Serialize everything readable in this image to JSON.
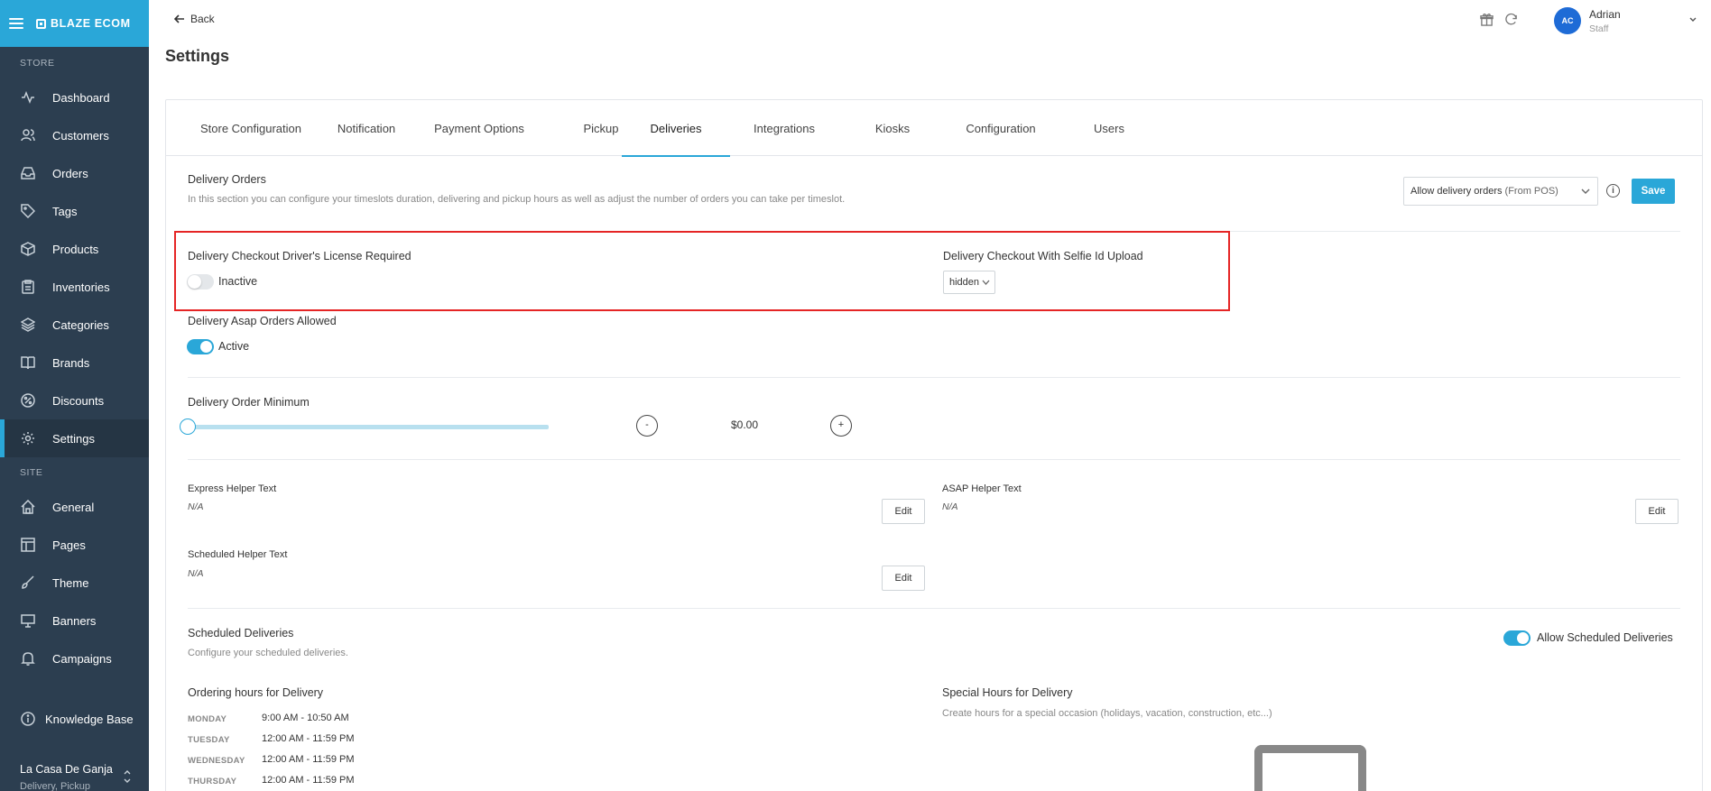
{
  "brand": {
    "name": "BLAZE ECOM"
  },
  "sidebar": {
    "store_label": "STORE",
    "site_label": "SITE",
    "store_items": [
      {
        "label": "Dashboard",
        "icon": "activity-icon"
      },
      {
        "label": "Customers",
        "icon": "users-icon"
      },
      {
        "label": "Orders",
        "icon": "inbox-icon"
      },
      {
        "label": "Tags",
        "icon": "tag-icon"
      },
      {
        "label": "Products",
        "icon": "box-icon"
      },
      {
        "label": "Inventories",
        "icon": "clipboard-icon"
      },
      {
        "label": "Categories",
        "icon": "layers-icon"
      },
      {
        "label": "Brands",
        "icon": "book-icon"
      },
      {
        "label": "Discounts",
        "icon": "percent-icon"
      },
      {
        "label": "Settings",
        "icon": "gear-icon",
        "active": true
      }
    ],
    "site_items": [
      {
        "label": "General",
        "icon": "home-icon"
      },
      {
        "label": "Pages",
        "icon": "layout-icon"
      },
      {
        "label": "Theme",
        "icon": "brush-icon"
      },
      {
        "label": "Banners",
        "icon": "monitor-icon"
      },
      {
        "label": "Campaigns",
        "icon": "bell-icon"
      }
    ],
    "knowledge_base": "Knowledge Base",
    "store_name": "La Casa De Ganja",
    "store_sub": "Delivery, Pickup"
  },
  "topbar": {
    "back_label": "Back",
    "page_title": "Settings",
    "user": {
      "initials": "AC",
      "name": "Adrian",
      "role": "Staff"
    }
  },
  "tabs": [
    {
      "label": "Store Configuration"
    },
    {
      "label": "Notification"
    },
    {
      "label": "Payment Options"
    },
    {
      "label": "Pickup"
    },
    {
      "label": "Deliveries",
      "active": true
    },
    {
      "label": "Integrations"
    },
    {
      "label": "Kiosks"
    },
    {
      "label": "Configuration"
    },
    {
      "label": "Users"
    }
  ],
  "delivery_orders": {
    "title": "Delivery Orders",
    "description": "In this section you can configure your timeslots duration, delivering and pickup hours as well as adjust the number of orders you can take per timeslot.",
    "select_value": "Allow delivery orders",
    "select_suffix": "(From POS)",
    "save_label": "Save"
  },
  "drivers_license": {
    "title": "Delivery Checkout Driver's License Required",
    "state": "Inactive"
  },
  "selfie": {
    "title": "Delivery Checkout With Selfie Id Upload",
    "value": "hidden"
  },
  "asap": {
    "title": "Delivery Asap Orders Allowed",
    "state": "Active"
  },
  "order_minimum": {
    "title": "Delivery Order Minimum",
    "value": "$0.00",
    "minus": "-",
    "plus": "+",
    "slider_fraction": 0
  },
  "helpers": {
    "express": {
      "title": "Express Helper Text",
      "value": "N/A",
      "edit": "Edit"
    },
    "asap": {
      "title": "ASAP Helper Text",
      "value": "N/A",
      "edit": "Edit"
    },
    "scheduled": {
      "title": "Scheduled Helper Text",
      "value": "N/A",
      "edit": "Edit"
    }
  },
  "scheduled_deliveries": {
    "title": "Scheduled Deliveries",
    "description": "Configure your scheduled deliveries.",
    "toggle_label": "Allow Scheduled Deliveries"
  },
  "ordering_hours": {
    "title": "Ordering hours for Delivery",
    "days": [
      {
        "day": "MONDAY",
        "hours": "9:00 AM - 10:50 AM"
      },
      {
        "day": "TUESDAY",
        "hours": "12:00 AM - 11:59 PM"
      },
      {
        "day": "WEDNESDAY",
        "hours": "12:00 AM - 11:59 PM"
      },
      {
        "day": "THURSDAY",
        "hours": "12:00 AM - 11:59 PM"
      }
    ]
  },
  "special_hours": {
    "title": "Special Hours for Delivery",
    "description": "Create hours for a special occasion (holidays, vacation, construction, etc...)"
  },
  "colors": {
    "accent": "#2aa7d8",
    "sidebar": "#2c3e50",
    "highlight": "#e52525"
  }
}
